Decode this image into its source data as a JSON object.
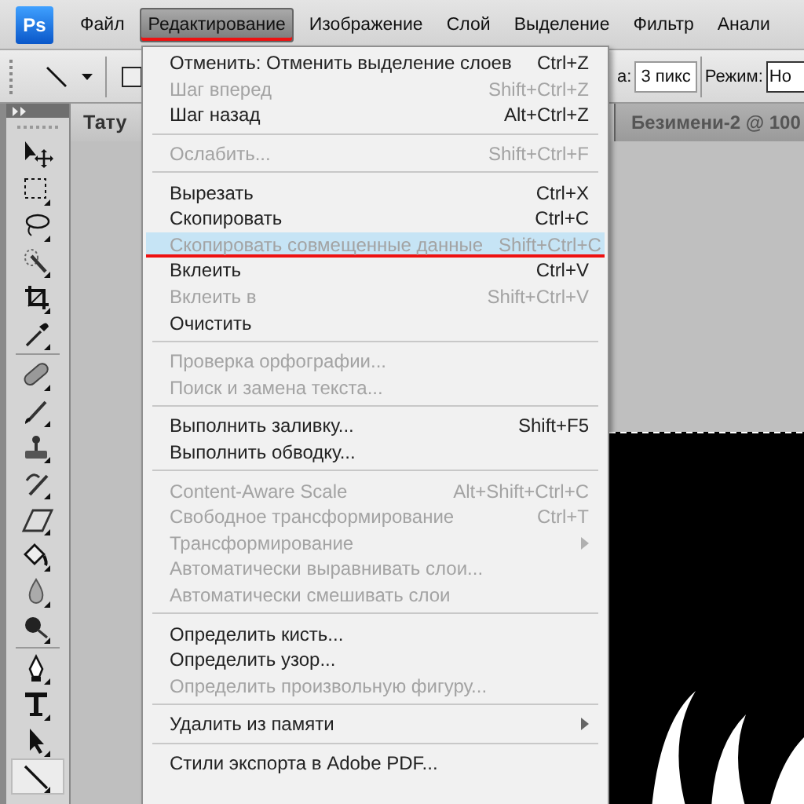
{
  "app_logo": "Ps",
  "menubar": [
    {
      "label": "Файл",
      "selected": false,
      "underlined": false
    },
    {
      "label": "Редактирование",
      "selected": true,
      "underlined": true
    },
    {
      "label": "Изображение",
      "selected": false,
      "underlined": false
    },
    {
      "label": "Слой",
      "selected": false,
      "underlined": false
    },
    {
      "label": "Выделение",
      "selected": false,
      "underlined": false
    },
    {
      "label": "Фильтр",
      "selected": false,
      "underlined": false
    },
    {
      "label": "Анали",
      "selected": false,
      "underlined": false
    }
  ],
  "options_bar": {
    "weight_label": "а:",
    "weight_value": "3 пикс",
    "mode_label": "Режим:",
    "mode_value": "Но"
  },
  "document_tabs": [
    {
      "label": "Тату",
      "selected": true
    },
    {
      "label": "Безимени-2 @ 100",
      "selected": false
    }
  ],
  "tool_groups": [
    [
      {
        "selected": false
      },
      {
        "selected": false
      },
      {
        "selected": false
      },
      {
        "selected": false
      },
      {
        "selected": false
      },
      {
        "selected": false
      }
    ],
    [
      {
        "selected": false
      },
      {
        "selected": false
      },
      {
        "selected": false
      },
      {
        "selected": false
      },
      {
        "selected": false
      },
      {
        "selected": false
      },
      {
        "selected": false
      },
      {
        "selected": false
      }
    ],
    [
      {
        "selected": false
      },
      {
        "selected": false
      },
      {
        "selected": false
      },
      {
        "selected": true
      }
    ]
  ],
  "edit_menu": [
    [
      {
        "label": "Отменить: Отменить выделение слоев",
        "shortcut": "Ctrl+Z",
        "disabled": false,
        "selected": false,
        "underlined": false,
        "submenu": false
      },
      {
        "label": "Шаг вперед",
        "shortcut": "Shift+Ctrl+Z",
        "disabled": true,
        "selected": false,
        "underlined": false,
        "submenu": false
      },
      {
        "label": "Шаг назад",
        "shortcut": "Alt+Ctrl+Z",
        "disabled": false,
        "selected": false,
        "underlined": false,
        "submenu": false
      }
    ],
    [
      {
        "label": "Ослабить...",
        "shortcut": "Shift+Ctrl+F",
        "disabled": true,
        "selected": false,
        "underlined": false,
        "submenu": false
      }
    ],
    [
      {
        "label": "Вырезать",
        "shortcut": "Ctrl+X",
        "disabled": false,
        "selected": false,
        "underlined": false,
        "submenu": false
      },
      {
        "label": "Скопировать",
        "shortcut": "Ctrl+C",
        "disabled": false,
        "selected": false,
        "underlined": false,
        "submenu": false
      },
      {
        "label": "Скопировать совмещенные данные",
        "shortcut": "Shift+Ctrl+C",
        "disabled": true,
        "selected": true,
        "underlined": true,
        "submenu": false
      },
      {
        "label": "Вклеить",
        "shortcut": "Ctrl+V",
        "disabled": false,
        "selected": false,
        "underlined": false,
        "submenu": false
      },
      {
        "label": "Вклеить в",
        "shortcut": "Shift+Ctrl+V",
        "disabled": true,
        "selected": false,
        "underlined": false,
        "submenu": false
      },
      {
        "label": "Очистить",
        "disabled": false,
        "selected": false,
        "underlined": false,
        "submenu": false
      }
    ],
    [
      {
        "label": "Проверка орфографии...",
        "disabled": true,
        "selected": false,
        "underlined": false,
        "submenu": false
      },
      {
        "label": "Поиск и замена текста...",
        "disabled": true,
        "selected": false,
        "underlined": false,
        "submenu": false
      }
    ],
    [
      {
        "label": "Выполнить заливку...",
        "shortcut": "Shift+F5",
        "disabled": false,
        "selected": false,
        "underlined": false,
        "submenu": false
      },
      {
        "label": "Выполнить обводку...",
        "disabled": false,
        "selected": false,
        "underlined": false,
        "submenu": false
      }
    ],
    [
      {
        "label": "Content-Aware Scale",
        "shortcut": "Alt+Shift+Ctrl+C",
        "disabled": true,
        "selected": false,
        "underlined": false,
        "submenu": false
      },
      {
        "label": "Свободное трансформирование",
        "shortcut": "Ctrl+T",
        "disabled": true,
        "selected": false,
        "underlined": false,
        "submenu": false
      },
      {
        "label": "Трансформирование",
        "disabled": true,
        "selected": false,
        "underlined": false,
        "submenu": true
      },
      {
        "label": "Автоматически выравнивать слои...",
        "disabled": true,
        "selected": false,
        "underlined": false,
        "submenu": false
      },
      {
        "label": "Автоматически смешивать слои",
        "disabled": true,
        "selected": false,
        "underlined": false,
        "submenu": false
      }
    ],
    [
      {
        "label": "Определить кисть...",
        "disabled": false,
        "selected": false,
        "underlined": false,
        "submenu": false
      },
      {
        "label": "Определить узор...",
        "disabled": false,
        "selected": false,
        "underlined": false,
        "submenu": false
      },
      {
        "label": "Определить произвольную фигуру...",
        "disabled": true,
        "selected": false,
        "underlined": false,
        "submenu": false
      }
    ],
    [
      {
        "label": "Удалить из памяти",
        "disabled": false,
        "selected": false,
        "underlined": false,
        "submenu": true
      }
    ],
    [
      {
        "label": "Стили экспорта в Adobe PDF...",
        "disabled": false,
        "selected": false,
        "underlined": false,
        "submenu": false
      }
    ]
  ]
}
